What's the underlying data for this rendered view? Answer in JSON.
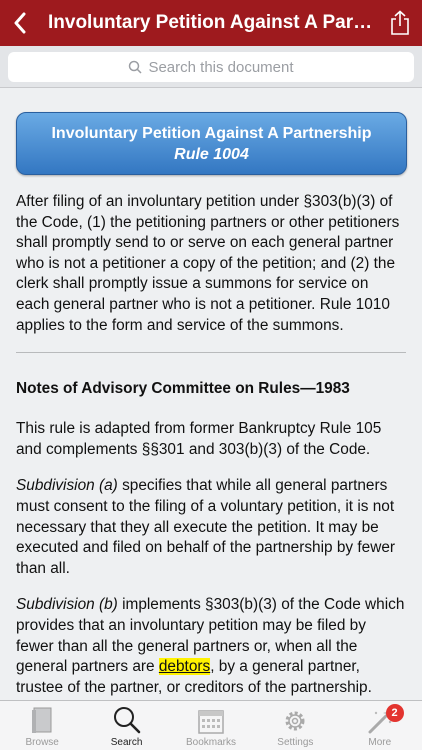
{
  "navbar": {
    "title": "Involuntary Petition Against A Partnership",
    "back_icon": "chevron-left-icon",
    "share_icon": "share-icon"
  },
  "search": {
    "placeholder": "Search this document"
  },
  "rule_button": {
    "title": "Involuntary Petition Against A Partnership",
    "rule": "Rule 1004"
  },
  "body": {
    "rule_text": "After filing of an involuntary petition under §303(b)(3) of the Code, (1) the petitioning partners or other petitioners shall promptly send to or serve on each general partner who is not a petitioner a copy of the petition; and (2) the clerk shall promptly issue a summons for service on each general partner who is not a petitioner. Rule 1010 applies to the form and service of the summons.",
    "notes_heading": "Notes of Advisory Committee on Rules—1983",
    "note_intro": "This rule is adapted from former Bankruptcy Rule 105 and complements §§301 and 303(b)(3) of the Code.",
    "sub_a_label": "Subdivision (a)",
    "sub_a_text": " specifies that while all general partners must consent to the filing of a voluntary petition, it is not necessary that they all execute the petition. It may be executed and filed on behalf of the partnership by fewer than all.",
    "sub_b_label": "Subdivision (b)",
    "sub_b_text": " implements §303(b)(3) of the Code which provides that an involuntary petition may be filed by fewer than all the general partners or, when all the general partners are ",
    "sub_b_highlight": "debtors",
    "sub_b_text_end": ", by a general partner, trustee of the partner, or creditors of the partnership."
  },
  "tabs": [
    {
      "label": "Browse",
      "icon": "book-icon"
    },
    {
      "label": "Search",
      "icon": "magnifier-icon"
    },
    {
      "label": "Bookmarks",
      "icon": "calendar-icon"
    },
    {
      "label": "Settings",
      "icon": "gear-icon"
    },
    {
      "label": "More",
      "icon": "magic-wand-icon",
      "badge": "2"
    }
  ],
  "colors": {
    "navbar": "#9e1a1e",
    "button": "#3f82ce",
    "highlight": "#fff200"
  }
}
